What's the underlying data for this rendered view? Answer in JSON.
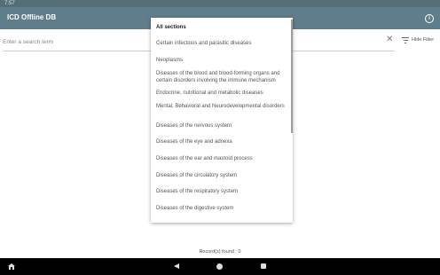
{
  "status": {
    "time": "7:57"
  },
  "app": {
    "title": "ICD Offline DB"
  },
  "search": {
    "placeholder": "Enter a search term",
    "value": "",
    "filter_label": "Hide Filter"
  },
  "dropdown": {
    "items": [
      "All sections",
      "Certain infectious and parasitic diseases",
      "Neoplasms",
      "Diseases of the blood and blood-forming organs and certain disorders involving the immune mechanism",
      "Endocrine, nutritional and metabolic diseases",
      "Mental, Behavioral and Neurodevelopmental disorders",
      "Diseases of the nervous system",
      "Diseases of the eye and adnexa",
      "Diseases of the ear and mastoid process",
      "Diseases of the circulatory system",
      "Diseases of the respiratory system",
      "Diseases of the digestive system"
    ],
    "selected": "All sections"
  },
  "footer": {
    "records": "Record(s) found : 0"
  },
  "colors": {
    "app_bar": "#607d8b",
    "status_bar": "#546e7a",
    "nav_bar": "#000000"
  },
  "icons": [
    "info-icon",
    "clear-icon",
    "filter-icon",
    "back-icon",
    "home-circle-icon",
    "recents-icon",
    "home-icon"
  ]
}
